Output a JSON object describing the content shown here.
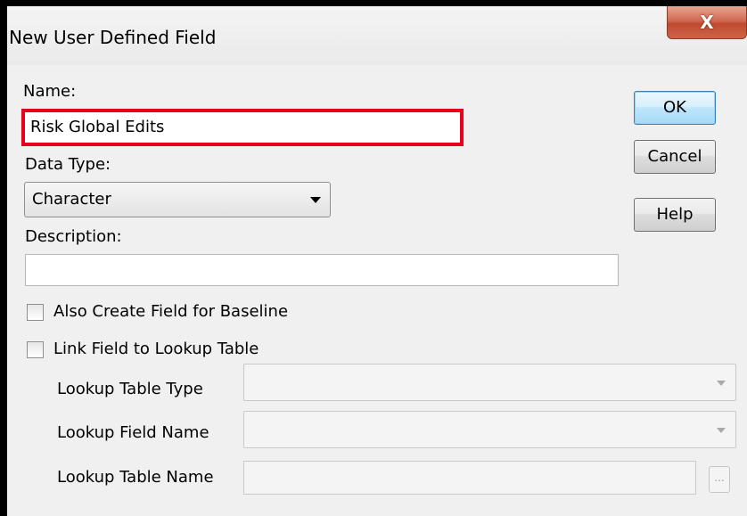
{
  "window": {
    "title": "New User Defined Field",
    "close_label": "X"
  },
  "form": {
    "name_label": "Name:",
    "name_value": "Risk Global Edits",
    "data_type_label": "Data Type:",
    "data_type_value": "Character",
    "description_label": "Description:",
    "description_value": "",
    "baseline_checkbox_label": "Also Create Field for Baseline",
    "baseline_checked": false,
    "lookup_checkbox_label": "Link Field to Lookup Table",
    "lookup_checked": false,
    "lookup_table_type_label": "Lookup Table Type",
    "lookup_table_type_value": "",
    "lookup_field_name_label": "Lookup Field Name",
    "lookup_field_name_value": "",
    "lookup_table_name_label": "Lookup Table Name",
    "lookup_table_name_value": "",
    "ellipsis_label": "..."
  },
  "buttons": {
    "ok": "OK",
    "cancel": "Cancel",
    "help": "Help"
  },
  "colors": {
    "highlight_border": "#e8001c",
    "default_button_border": "#3c7fb1",
    "close_button": "#c04a30"
  },
  "icons": {
    "close": "close-icon",
    "dropdown": "chevron-down-icon"
  }
}
